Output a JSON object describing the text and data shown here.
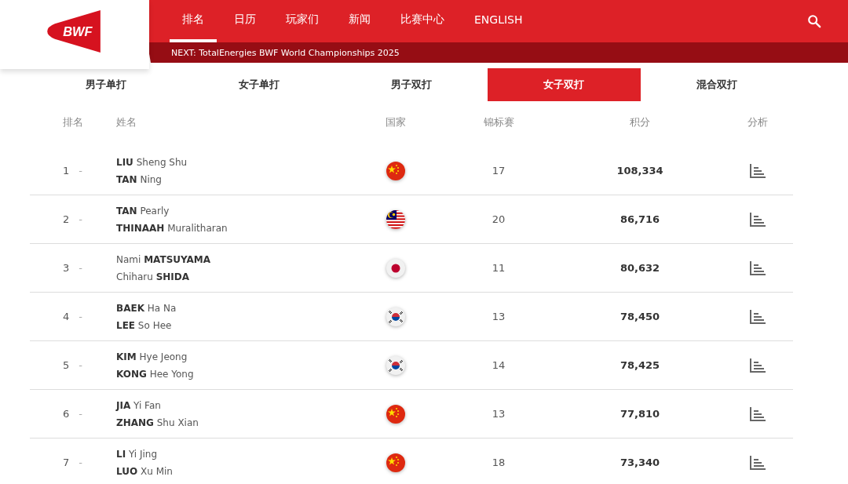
{
  "nav": {
    "items": [
      {
        "label": "排名",
        "selected": true
      },
      {
        "label": "日历",
        "selected": false
      },
      {
        "label": "玩家们",
        "selected": false
      },
      {
        "label": "新闻",
        "selected": false
      },
      {
        "label": "比赛中心",
        "selected": false
      },
      {
        "label": "ENGLISH",
        "selected": false
      }
    ],
    "next": "NEXT: TotalEnergies BWF World Championships 2025"
  },
  "logo": {
    "text": "BWF"
  },
  "tabs": [
    {
      "label": "男子单打",
      "selected": false
    },
    {
      "label": "女子单打",
      "selected": false
    },
    {
      "label": "男子双打",
      "selected": false
    },
    {
      "label": "女子双打",
      "selected": true
    },
    {
      "label": "混合双打",
      "selected": false
    }
  ],
  "table": {
    "columns": [
      "排名",
      "姓名",
      "国家",
      "锦标赛",
      "积分",
      "分析"
    ],
    "rows": [
      {
        "rank": "1",
        "move": "-",
        "players": [
          "**LIU** Sheng Shu",
          "**TAN** Ning"
        ],
        "kind": "cn",
        "tournaments": "17",
        "points": "108,334"
      },
      {
        "rank": "2",
        "move": "-",
        "players": [
          "**TAN** Pearly",
          "**THINAAH** Muralitharan"
        ],
        "kind": "my",
        "tournaments": "20",
        "points": "86,716"
      },
      {
        "rank": "3",
        "move": "-",
        "players": [
          "Nami **MATSUYAMA**",
          "Chiharu **SHIDA**"
        ],
        "kind": "jp",
        "tournaments": "11",
        "points": "80,632"
      },
      {
        "rank": "4",
        "move": "-",
        "players": [
          "**BAEK** Ha Na",
          "**LEE** So Hee"
        ],
        "kind": "kr",
        "tournaments": "13",
        "points": "78,450"
      },
      {
        "rank": "5",
        "move": "-",
        "players": [
          "**KIM** Hye Jeong",
          "**KONG** Hee Yong"
        ],
        "kind": "kr",
        "tournaments": "14",
        "points": "78,425"
      },
      {
        "rank": "6",
        "move": "-",
        "players": [
          "**JIA** Yi Fan",
          "**ZHANG** Shu Xian"
        ],
        "kind": "cn",
        "tournaments": "13",
        "points": "77,810"
      },
      {
        "rank": "7",
        "move": "-",
        "players": [
          "**LI** Yi Jing",
          "**LUO** Xu Min"
        ],
        "kind": "cn",
        "tournaments": "18",
        "points": "73,340"
      }
    ]
  }
}
